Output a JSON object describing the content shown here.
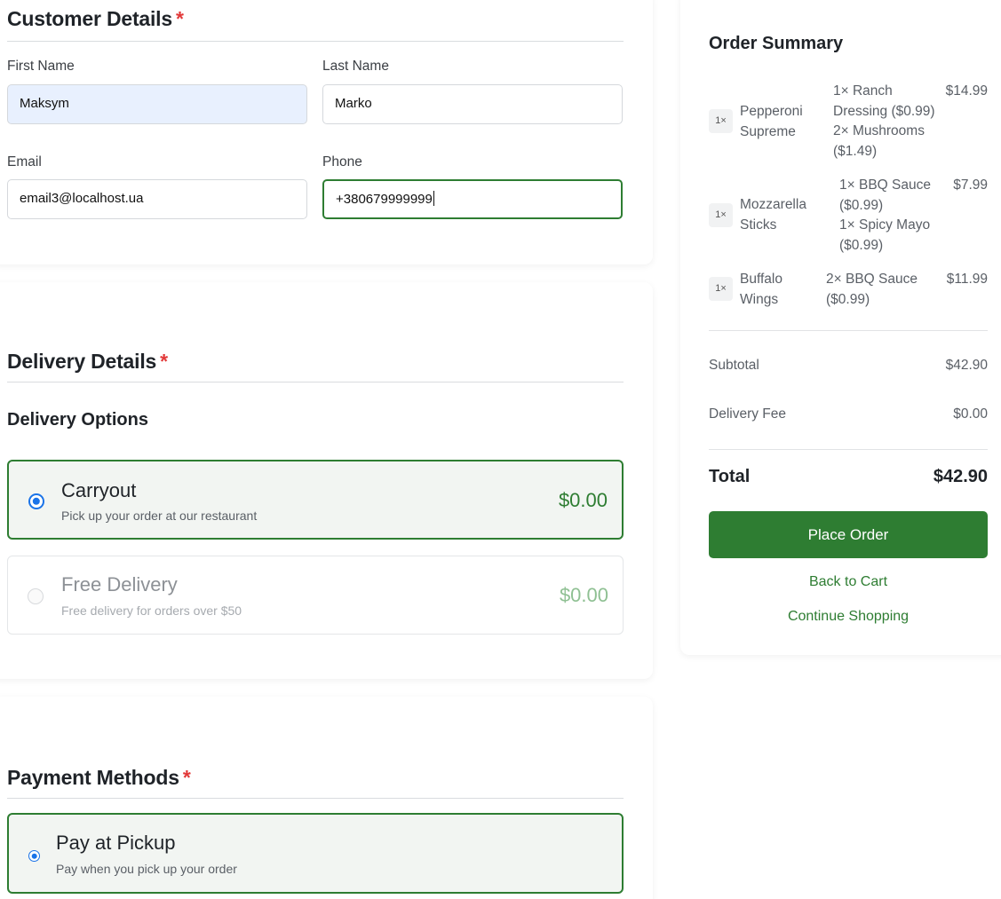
{
  "customer": {
    "title": "Customer Details",
    "required_mark": "*",
    "first_name": {
      "label": "First Name",
      "value": "Maksym"
    },
    "last_name": {
      "label": "Last Name",
      "value": "Marko"
    },
    "email": {
      "label": "Email",
      "value": "email3@localhost.ua"
    },
    "phone": {
      "label": "Phone",
      "value": "+380679999999"
    }
  },
  "delivery": {
    "title": "Delivery Details",
    "required_mark": "*",
    "options_title": "Delivery Options",
    "options": [
      {
        "title": "Carryout",
        "desc": "Pick up your order at our restaurant",
        "price": "$0.00",
        "selected": true
      },
      {
        "title": "Free Delivery",
        "desc": "Free delivery for orders over $50",
        "price": "$0.00",
        "selected": false,
        "disabled": true
      }
    ]
  },
  "payment": {
    "title": "Payment Methods",
    "required_mark": "*",
    "options": [
      {
        "title": "Pay at Pickup",
        "desc": "Pay when you pick up your order",
        "selected": true
      }
    ]
  },
  "summary": {
    "title": "Order Summary",
    "items": [
      {
        "qty": "1×",
        "name_line1": "Pepperoni",
        "name_line2": "Supreme",
        "mods": [
          "1× Ranch",
          "Dressing ($0.99)",
          "2× Mushrooms",
          "($1.49)"
        ],
        "price": "$14.99"
      },
      {
        "qty": "1×",
        "name_line1": "Mozzarella",
        "name_line2": "Sticks",
        "mods": [
          "1× BBQ Sauce",
          "($0.99)",
          "1× Spicy Mayo",
          "($0.99)"
        ],
        "price": "$7.99"
      },
      {
        "qty": "1×",
        "name_line1": "Buffalo",
        "name_line2": "Wings",
        "mods": [
          "2× BBQ Sauce",
          "($0.99)"
        ],
        "price": "$11.99"
      }
    ],
    "subtotal_label": "Subtotal",
    "subtotal_value": "$42.90",
    "delivery_fee_label": "Delivery Fee",
    "delivery_fee_value": "$0.00",
    "total_label": "Total",
    "total_value": "$42.90",
    "place_order": "Place Order",
    "back_to_cart": "Back to Cart",
    "continue_shopping": "Continue Shopping"
  },
  "colors": {
    "accent_green": "#2e7d32",
    "radio_blue": "#1a73e8",
    "required_red": "#e23a3a"
  }
}
